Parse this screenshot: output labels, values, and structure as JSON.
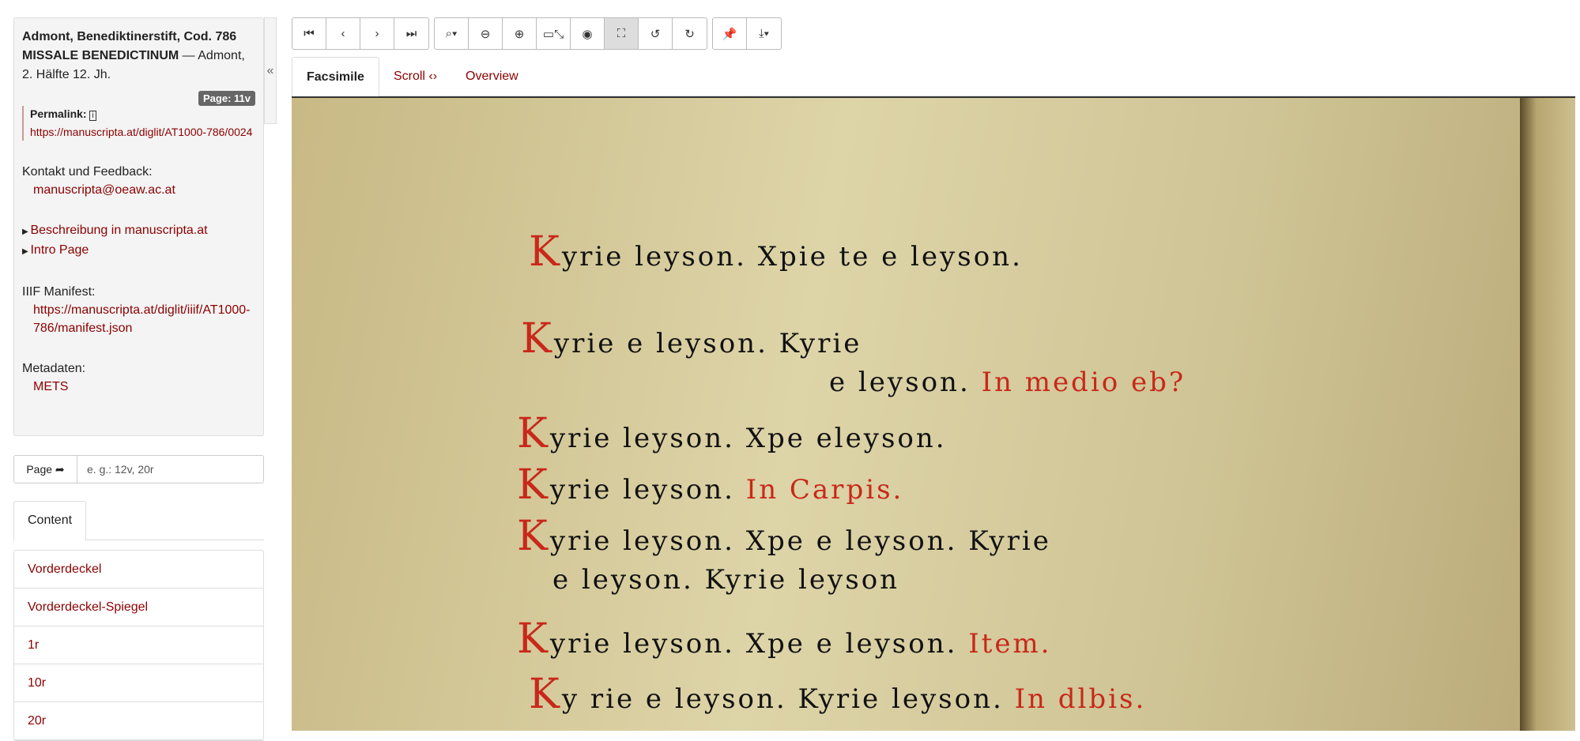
{
  "info": {
    "title_bold": "Admont, Benediktinerstift, Cod. 786 MISSALE BENEDICTINUM",
    "title_rest": " — Admont, 2. Hälfte 12. Jh.",
    "page_badge": "Page: 11v",
    "permalink_label": "Permalink:",
    "permalink": "https://manuscripta.at/diglit/AT1000-786/0024",
    "contact_label": "Kontakt und Feedback:",
    "contact_email": "manuscripta@oeaw.ac.at",
    "desc_link": "Beschreibung in manuscripta.at",
    "intro_link": "Intro Page",
    "iiif_label": "IIIF Manifest:",
    "iiif_url": "https://manuscripta.at/diglit/iiif/AT1000-786/manifest.json",
    "meta_label": "Metadaten:",
    "meta_link": "METS"
  },
  "page_nav": {
    "button": "Page ➦",
    "placeholder": "e. g.: 12v, 20r"
  },
  "content_tab": "Content",
  "content_items": [
    "Vorderdeckel",
    "Vorderdeckel-Spiegel",
    "1r",
    "10r",
    "20r"
  ],
  "tabs": {
    "facsimile": "Facsimile",
    "scroll": "Scroll ‹›",
    "overview": "Overview"
  },
  "collapse": "«",
  "toolbar": {
    "first": "⏮",
    "prev": "‹",
    "next": "›",
    "last": "⏭",
    "zoom_menu": "⌕▾",
    "zoom_out": "⊖",
    "zoom_in": "⊕",
    "screen": "▭⤡",
    "eye": "◉",
    "fit": "⛶",
    "rot_left": "↺",
    "rot_right": "↻",
    "pin": "📌",
    "download": "⤓▾"
  },
  "image_text": [
    "Kyrie  leyson. Xpie  te  e   leyson.",
    "Kyrie   e  leyson. Kyrie",
    "e  leyson.   In medio eb?",
    "Kyrie   leyson. Xpe   eleyson.",
    "Kyrie   leyson.   In Carpis.",
    "Kyrie  leyson. Xpe  e  leyson. Kyrie",
    "e  leyson. Kyrie   leyson",
    "Kyrie  leyson. Xpe  e  leyson.  Item.",
    "Ky rie  e  leyson. Kyrie  leyson. In dlbis."
  ]
}
